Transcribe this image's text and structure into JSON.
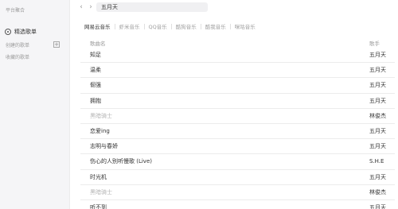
{
  "sidebar": {
    "section_platform": "平台聚合",
    "featured_label": "精选歌单",
    "created_label": "创建的歌单",
    "add_symbol": "+",
    "collected_label": "收藏的歌单"
  },
  "header": {
    "back_symbol": "‹",
    "forward_symbol": "›",
    "search_value": "五月天"
  },
  "tabs": [
    "网易云音乐",
    "虾米音乐",
    "QQ音乐",
    "酷狗音乐",
    "酷我音乐",
    "咪咕音乐"
  ],
  "table": {
    "col_song": "歌曲名",
    "col_singer": "歌手",
    "rows": [
      {
        "song": "知足",
        "singer": "五月天",
        "dim": false
      },
      {
        "song": "温柔",
        "singer": "五月天",
        "dim": false
      },
      {
        "song": "倔强",
        "singer": "五月天",
        "dim": false
      },
      {
        "song": "拥抱",
        "singer": "五月天",
        "dim": false
      },
      {
        "song": "黑暗骑士",
        "singer": "林俊杰",
        "dim": true
      },
      {
        "song": "恋爱ing",
        "singer": "五月天",
        "dim": false
      },
      {
        "song": "志明与春娇",
        "singer": "五月天",
        "dim": false
      },
      {
        "song": "伤心的人别听慢歌 (Live)",
        "singer": "S.H.E",
        "dim": false
      },
      {
        "song": "时光机",
        "singer": "五月天",
        "dim": false
      },
      {
        "song": "黑暗骑士",
        "singer": "林俊杰",
        "dim": true
      },
      {
        "song": "听不到",
        "singer": "五月天",
        "dim": false
      }
    ]
  }
}
